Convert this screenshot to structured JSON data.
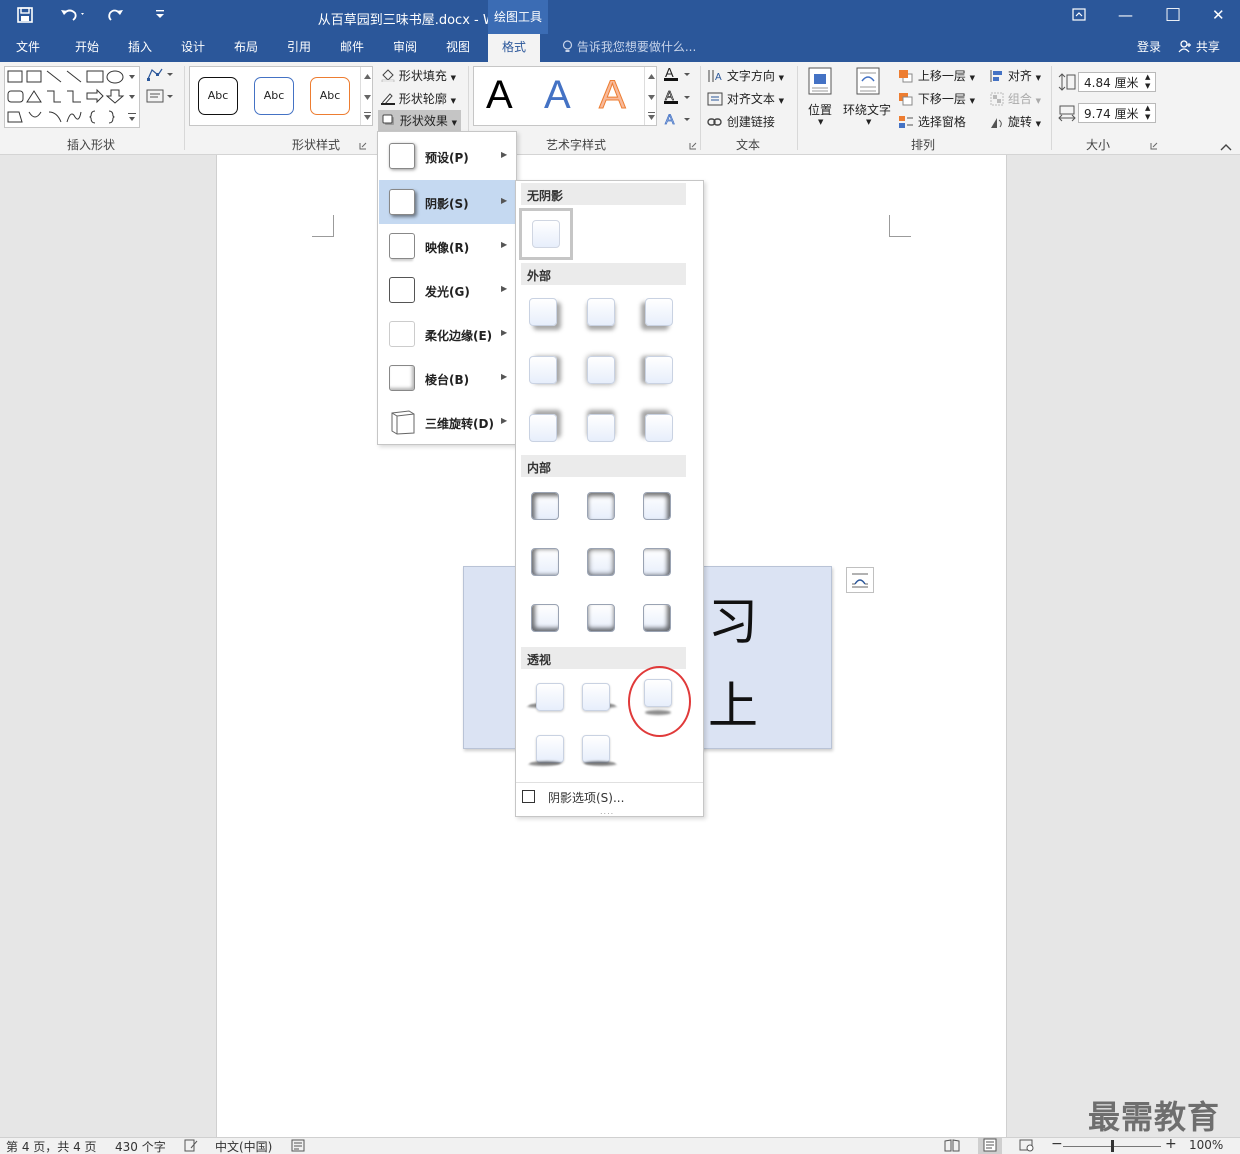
{
  "titlebar": {
    "title": "从百草园到三味书屋.docx - Word",
    "contextual_tab": "绘图工具",
    "save_icon": "save-icon",
    "undo_icon": "undo-icon",
    "redo_icon": "redo-icon",
    "customize_icon": "customize-qat-icon",
    "restore_ribbon_icon": "ribbon-display-icon",
    "minimize": "—",
    "maximize": "□",
    "close": "✕"
  },
  "tabs": [
    "文件",
    "开始",
    "插入",
    "设计",
    "布局",
    "引用",
    "邮件",
    "审阅",
    "视图",
    "格式"
  ],
  "active_tab": "格式",
  "tellme": "告诉我您想要做什么...",
  "account": {
    "login": "登录",
    "share": "共享"
  },
  "ribbon": {
    "groups": {
      "insert_shapes": "插入形状",
      "shape_styles": "形状样式",
      "wordart_styles": "艺术字样式",
      "text": "文本",
      "arrange": "排列",
      "size": "大小"
    },
    "style_samples": [
      "Abc",
      "Abc",
      "Abc"
    ],
    "shape_fill": "形状填充",
    "shape_outline": "形状轮廓",
    "shape_effects": "形状效果",
    "wordart_letters": [
      "A",
      "A",
      "A"
    ],
    "text_direction": "文字方向",
    "align_text": "对齐文本",
    "create_link": "创建链接",
    "position": "位置",
    "wrap_text": "环绕文字",
    "bring_forward": "上移一层",
    "send_backward": "下移一层",
    "selection_pane": "选择窗格",
    "align": "对齐",
    "group": "组合",
    "rotate": "旋转",
    "height": "4.84 厘米",
    "width": "9.74 厘米"
  },
  "effects_menu": {
    "items": [
      {
        "label": "预设(P)"
      },
      {
        "label": "阴影(S)"
      },
      {
        "label": "映像(R)"
      },
      {
        "label": "发光(G)"
      },
      {
        "label": "柔化边缘(E)"
      },
      {
        "label": "棱台(B)"
      },
      {
        "label": "三维旋转(D)"
      }
    ],
    "highlighted_index": 1
  },
  "shadow_menu": {
    "sections": {
      "none": "无阴影",
      "outer": "外部",
      "inner": "内部",
      "perspective": "透视"
    },
    "options_label": "阴影选项(S)..."
  },
  "document": {
    "shape_chars": [
      "习",
      "上"
    ]
  },
  "statusbar": {
    "page": "第 4 页，共 4 页",
    "words": "430 个字",
    "language": "中文(中国)",
    "zoom": "100%",
    "zoom_level": 100
  },
  "watermark": "最需教育",
  "colors": {
    "brand": "#2b579a",
    "highlight": "#c5d9f1",
    "annotation": "#e03a3a",
    "shape_fill": "#dbe3f3"
  }
}
